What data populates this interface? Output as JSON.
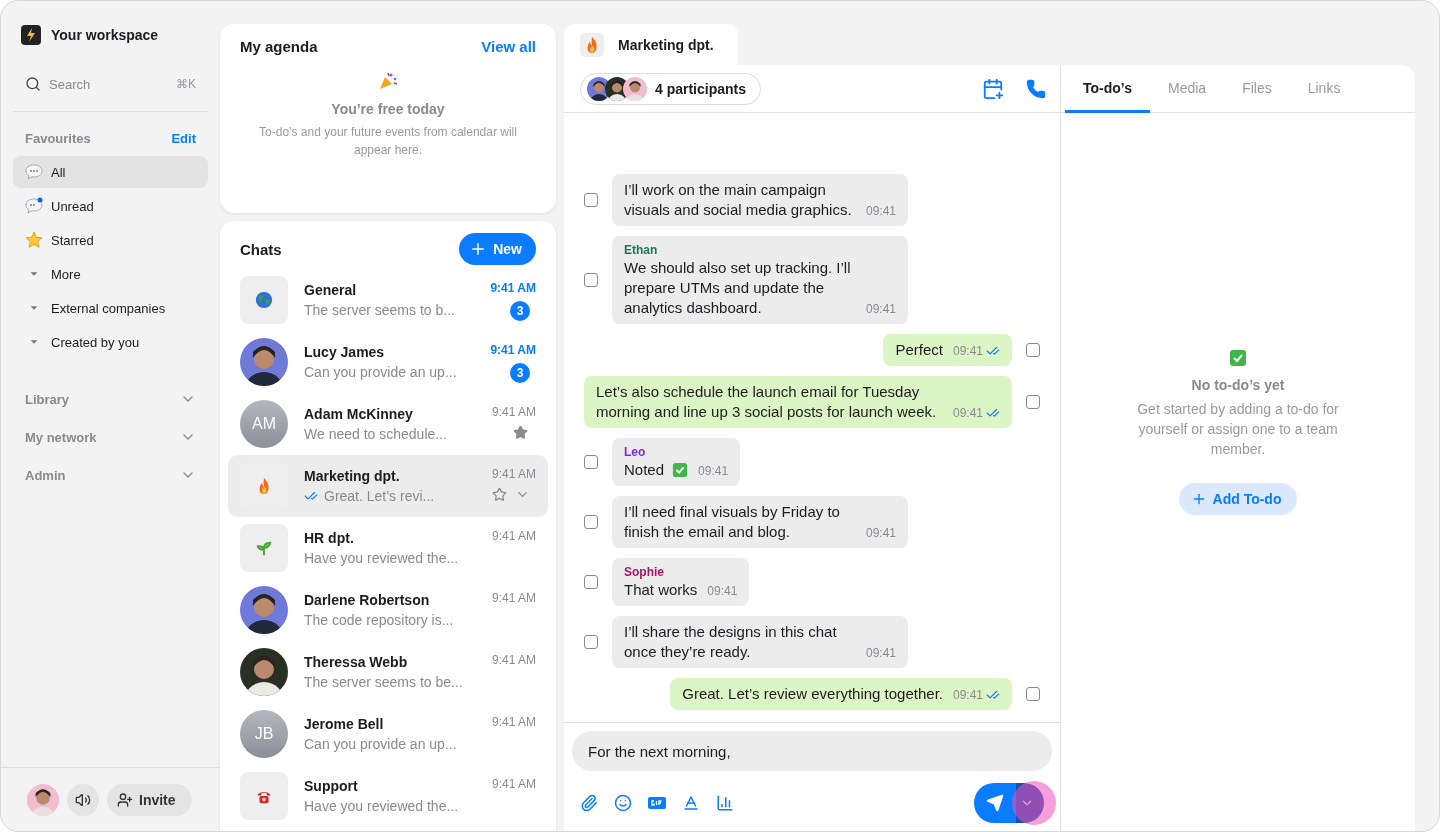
{
  "workspace": {
    "title": "Your workspace"
  },
  "search": {
    "placeholder": "Search",
    "shortcut": "⌘K"
  },
  "favourites": {
    "title": "Favourites",
    "edit": "Edit",
    "items": [
      {
        "label": "All",
        "kind": "bubble",
        "selected": true
      },
      {
        "label": "Unread",
        "kind": "unread",
        "selected": false
      },
      {
        "label": "Starred",
        "kind": "star",
        "selected": false
      },
      {
        "label": "More",
        "kind": "caret",
        "selected": false
      },
      {
        "label": "External companies",
        "kind": "caret",
        "selected": false
      },
      {
        "label": "Created by you",
        "kind": "caret",
        "selected": false
      }
    ]
  },
  "sections": [
    {
      "label": "Library",
      "expanded": false
    },
    {
      "label": "My network",
      "expanded": false
    },
    {
      "label": "Admin",
      "expanded": false
    }
  ],
  "footer": {
    "invite": "Invite"
  },
  "agenda": {
    "title": "My agenda",
    "link": "View all",
    "empty_title": "You’re free today",
    "empty_text": "To-do’s and your future events from calendar will appear here."
  },
  "chats": {
    "title": "Chats",
    "new": "New",
    "items": [
      {
        "kind": "globe",
        "name": "General",
        "preview": "The server seems to b...",
        "time": "9:41 AM",
        "unread": true,
        "badge": "3",
        "starred": false,
        "selected": false,
        "read": false
      },
      {
        "name": "Lucy James",
        "preview": "Can you provide an up...",
        "time": "9:41 AM",
        "unread": true,
        "badge": "3",
        "starred": false,
        "selected": false,
        "read": false
      },
      {
        "kind": "initials",
        "initials": "AM",
        "name": "Adam McKinney",
        "preview": "We need to schedule...",
        "time": "9:41 AM",
        "unread": false,
        "starred": true,
        "selected": false,
        "read": false
      },
      {
        "kind": "fire",
        "name": "Marketing dpt.",
        "preview": "Great. Let’s revi...",
        "time": "9:41 AM",
        "unread": false,
        "starred": false,
        "selected": true,
        "read": true
      },
      {
        "kind": "sprout",
        "name": "HR dpt.",
        "preview": "Have you reviewed the...",
        "time": "9:41 AM",
        "unread": false,
        "starred": false,
        "selected": false,
        "read": false
      },
      {
        "name": "Darlene Robertson",
        "preview": "The code repository is...",
        "time": "9:41 AM",
        "unread": false,
        "starred": false,
        "selected": false,
        "read": false
      },
      {
        "name": "Theressa Webb",
        "preview": "The server seems to be...",
        "time": "9:41 AM",
        "unread": false,
        "starred": false,
        "selected": false,
        "read": false
      },
      {
        "kind": "initials",
        "initials": "JB",
        "name": "Jerome Bell",
        "preview": "Can you provide an up...",
        "time": "9:41 AM",
        "unread": false,
        "starred": false,
        "selected": false,
        "read": false
      },
      {
        "kind": "phone",
        "name": "Support",
        "preview": "Have you reviewed the...",
        "time": "9:41 AM",
        "unread": false,
        "starred": false,
        "selected": false,
        "read": false
      }
    ]
  },
  "conversation": {
    "tab": "Marketing dpt.",
    "participants": "4 participants",
    "messages": [
      {
        "kind": "in",
        "text": "I’ll work on the main campaign visuals and social media graphics.",
        "time": "09:41",
        "checked": false
      },
      {
        "kind": "in",
        "sender": "Ethan",
        "color": "#1a7a4a",
        "text": "We should also set up tracking. I’ll prepare UTMs and update the analytics dashboard.",
        "time": "09:41",
        "checked": false
      },
      {
        "kind": "out",
        "text": "Perfect",
        "time": "09:41",
        "checked": false
      },
      {
        "kind": "out",
        "text": "Let’s also schedule the launch email for Tuesday morning and line up 3 social posts for launch week.",
        "time": "09:41",
        "checked": false
      },
      {
        "kind": "in",
        "sender": "Leo",
        "color": "#7b2fd6",
        "text": "Noted",
        "done_icon": true,
        "time": "09:41",
        "checked": false
      },
      {
        "kind": "in",
        "text": "I’ll need final visuals by Friday to finish the email and blog.",
        "time": "09:41",
        "checked": false
      },
      {
        "kind": "in",
        "sender": "Sophie",
        "color": "#a3156b",
        "text": "That works",
        "time": "09:41",
        "checked": false
      },
      {
        "kind": "in",
        "text": "I’ll share the designs in this chat once they’re ready.",
        "time": "09:41",
        "checked": false
      },
      {
        "kind": "out",
        "text": "Great. Let’s review everything together.",
        "time": "09:41",
        "checked": false
      }
    ],
    "composer": {
      "value": "For the next morning,"
    }
  },
  "details": {
    "tabs": [
      {
        "label": "To-do’s",
        "selected": true
      },
      {
        "label": "Media",
        "selected": false
      },
      {
        "label": "Files",
        "selected": false
      },
      {
        "label": "Links",
        "selected": false
      }
    ],
    "empty_title": "No to-do’s yet",
    "empty_text": "Get started by adding a to-do for yourself or assign one to a team member.",
    "add": "Add To-do"
  }
}
